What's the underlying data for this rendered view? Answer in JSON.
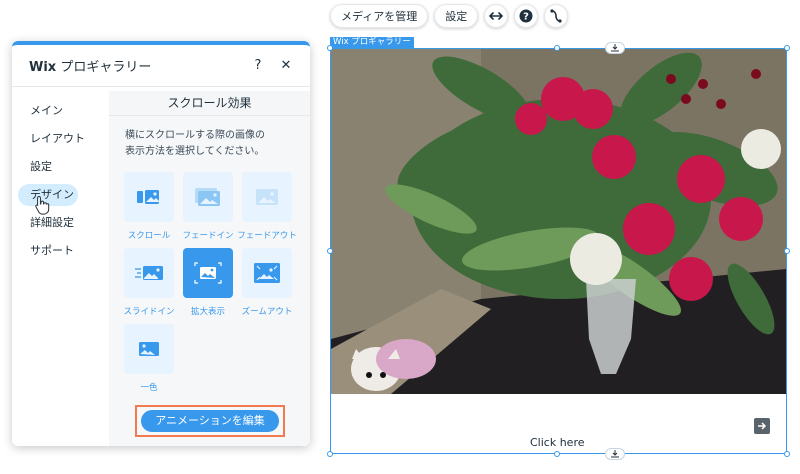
{
  "toolbar": {
    "manage_media": "メディアを管理",
    "settings": "設定",
    "icons": [
      "stretch-icon",
      "help-icon",
      "animation-icon"
    ]
  },
  "panel": {
    "title_bold": "Wix",
    "title_rest": " プロギャラリー",
    "help": "?",
    "close": "✕",
    "sidebar": [
      {
        "label": "メイン"
      },
      {
        "label": "レイアウト"
      },
      {
        "label": "設定"
      },
      {
        "label": "デザイン"
      },
      {
        "label": "詳細設定"
      },
      {
        "label": "サポート"
      }
    ],
    "section_title": "スクロール効果",
    "description": "横にスクロールする際の画像の表示方法を選択してください。",
    "options": [
      {
        "label": "スクロール",
        "icon": "scroll-icon"
      },
      {
        "label": "フェードイン",
        "icon": "fade-in-icon"
      },
      {
        "label": "フェードアウト",
        "icon": "fade-out-icon"
      },
      {
        "label": "スライドイン",
        "icon": "slide-in-icon"
      },
      {
        "label": "拡大表示",
        "icon": "expand-icon",
        "selected": true
      },
      {
        "label": "ズームアウト",
        "icon": "zoom-out-icon"
      },
      {
        "label": "一色",
        "icon": "one-color-icon"
      }
    ],
    "edit_animation": "アニメーションを編集"
  },
  "gallery": {
    "tag": "Wix プロギャラリー",
    "click_here": "Click here"
  },
  "colors": {
    "accent": "#3899ec",
    "highlight": "#f17a4e",
    "active_pill": "#d3edff"
  }
}
